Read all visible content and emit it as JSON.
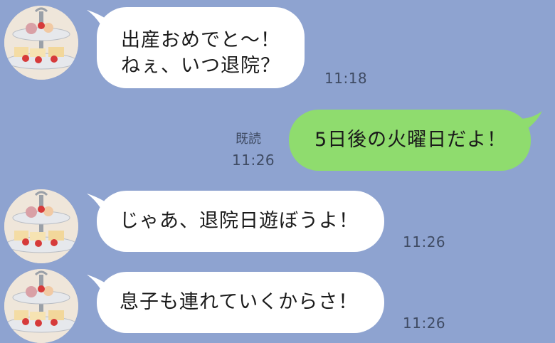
{
  "chat": {
    "messages": [
      {
        "sender": "friend",
        "lines": [
          "出産おめでと～！",
          "ねぇ、いつ退院？"
        ],
        "time": "11:18"
      },
      {
        "sender": "me",
        "lines": [
          "5日後の火曜日だよ！"
        ],
        "time": "11:26",
        "read": "既読"
      },
      {
        "sender": "friend",
        "lines": [
          "じゃあ、退院日遊ぼうよ！"
        ],
        "time": "11:26"
      },
      {
        "sender": "friend",
        "lines": [
          "息子も連れていくからさ！"
        ],
        "time": "11:26"
      }
    ]
  },
  "colors": {
    "background": "#8ea3d0",
    "incoming_bubble": "#ffffff",
    "outgoing_bubble": "#8fdc6e"
  },
  "icons": {
    "avatar": "afternoon-tea-stand-photo"
  }
}
